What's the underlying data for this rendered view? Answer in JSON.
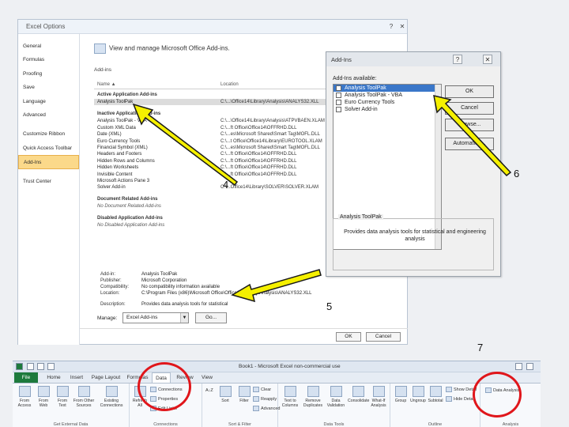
{
  "options_dialog": {
    "title": "Excel Options",
    "sidebar": [
      "General",
      "Formulas",
      "Proofing",
      "Save",
      "Language",
      "Advanced",
      "Customize Ribbon",
      "Quick Access Toolbar",
      "Add-Ins",
      "Trust Center"
    ],
    "selected_sidebar": "Add-Ins",
    "heading": "View and manage Microsoft Office Add-ins.",
    "subheading": "Add-ins",
    "col_name": "Name ▲",
    "col_location": "Location",
    "active_header": "Active Application Add-ins",
    "active_rows": [
      {
        "name": "Analysis ToolPak",
        "location": "C:\\...\\Office14\\Library\\Analysis\\ANALYS32.XLL"
      }
    ],
    "inactive_header": "Inactive Application Add-ins",
    "inactive_rows": [
      {
        "name": "Analysis ToolPak - VBA",
        "location": "C:\\...\\Office14\\Library\\Analysis\\ATPVBAEN.XLAM"
      },
      {
        "name": "Custom XML Data",
        "location": "C:\\...ft Office\\Office14\\OFFRHD.DLL"
      },
      {
        "name": "Date (XML)",
        "location": "C:\\...es\\Microsoft Shared\\Smart Tag\\MOFL.DLL"
      },
      {
        "name": "Euro Currency Tools",
        "location": "C:\\...t Office\\Office14\\Library\\EUROTOOL.XLAM"
      },
      {
        "name": "Financial Symbol (XML)",
        "location": "C:\\...es\\Microsoft Shared\\Smart Tag\\MOFL.DLL"
      },
      {
        "name": "Headers and Footers",
        "location": "C:\\...ft Office\\Office14\\OFFRHD.DLL"
      },
      {
        "name": "Hidden Rows and Columns",
        "location": "C:\\...ft Office\\Office14\\OFFRHD.DLL"
      },
      {
        "name": "Hidden Worksheets",
        "location": "C:\\...ft Office\\Office14\\OFFRHD.DLL"
      },
      {
        "name": "Invisible Content",
        "location": "C:\\...ft Office\\Office14\\OFFRHD.DLL"
      },
      {
        "name": "Microsoft Actions Pane 3",
        "location": ""
      },
      {
        "name": "Solver Add-in",
        "location": "C:\\...Office14\\Library\\SOLVER\\SOLVER.XLAM"
      }
    ],
    "document_header": "Document Related Add-ins",
    "document_none": "No Document Related Add-ins",
    "disabled_header": "Disabled Application Add-ins",
    "disabled_none": "No Disabled Application Add-ins",
    "details": [
      {
        "key": "Add-in:",
        "value": "Analysis ToolPak"
      },
      {
        "key": "Publisher:",
        "value": "Microsoft Corporation"
      },
      {
        "key": "Compatibility:",
        "value": "No compatibility information available"
      },
      {
        "key": "Location:",
        "value": "C:\\Program Files (x86)\\Microsoft Office\\Office14\\Library\\Analysis\\ANALYS32.XLL"
      },
      {
        "key": "Description:",
        "value": "Provides data analysis tools for statistical"
      }
    ],
    "manage_label": "Manage:",
    "manage_value": "Excel Add-ins",
    "go_label": "Go...",
    "ok_label": "OK",
    "cancel_label": "Cancel"
  },
  "addins_dialog": {
    "title": "Add-Ins",
    "available_label": "Add-Ins available:",
    "items": [
      {
        "label": "Analysis ToolPak",
        "checked": true,
        "selected": true
      },
      {
        "label": "Analysis ToolPak - VBA",
        "checked": false,
        "selected": false
      },
      {
        "label": "Euro Currency Tools",
        "checked": false,
        "selected": false
      },
      {
        "label": "Solver Add-in",
        "checked": false,
        "selected": false
      }
    ],
    "ok_label": "OK",
    "cancel_label": "Cancel",
    "browse_label": "Browse...",
    "automation_label": "Automation...",
    "desc_title": "Analysis ToolPak",
    "desc_text": "Provides data analysis tools for statistical and engineering analysis"
  },
  "annotations": {
    "step4": "4",
    "step5": "5",
    "step6": "6",
    "step7": "7"
  },
  "annotation_colors": {
    "arrow_fill": "#f5f000",
    "arrow_stroke": "#1a1a1a",
    "ring": "#e0161b"
  },
  "ribbon": {
    "window_title": "Book1 - Microsoft Excel non-commercial use",
    "tabs": [
      "File",
      "Home",
      "Insert",
      "Page Layout",
      "Formulas",
      "Data",
      "Review",
      "View"
    ],
    "active_tab": "Data",
    "groups": {
      "external": {
        "label": "Get External Data",
        "cmds": [
          "From Access",
          "From Web",
          "From Text",
          "From Other Sources",
          "Existing Connections"
        ]
      },
      "connections": {
        "label": "Connections",
        "refresh": "Refresh All",
        "items": [
          "Connections",
          "Properties",
          "Edit Links"
        ]
      },
      "sort": {
        "label": "Sort & Filter",
        "sort_az": "A↓Z",
        "sort": "Sort",
        "filter": "Filter",
        "items": [
          "Clear",
          "Reapply",
          "Advanced"
        ]
      },
      "tools": {
        "label": "Data Tools",
        "cmds": [
          "Text to Columns",
          "Remove Duplicates",
          "Data Validation",
          "Consolidate",
          "What-If Analysis"
        ]
      },
      "outline": {
        "label": "Outline",
        "cmds": [
          "Group",
          "Ungroup",
          "Subtotal"
        ],
        "items": [
          "Show Detail",
          "Hide Detail"
        ]
      },
      "analysis": {
        "label": "Analysis",
        "item": "Data Analysis"
      }
    }
  }
}
